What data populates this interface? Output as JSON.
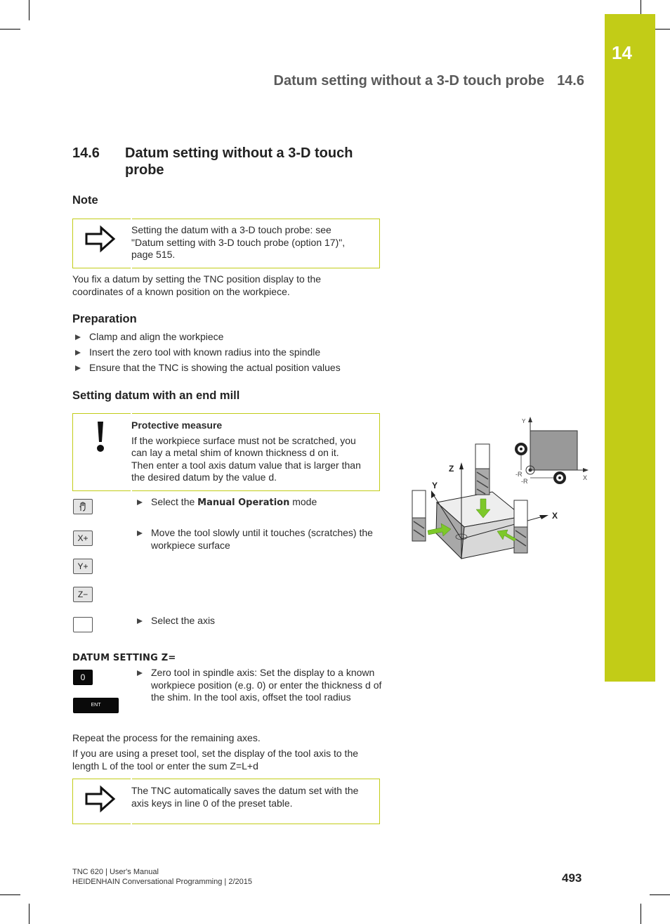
{
  "chapter": {
    "number": "14"
  },
  "running_header": {
    "title": "Datum setting without a 3-D touch probe",
    "section": "14.6"
  },
  "section": {
    "number": "14.6",
    "title": "Datum setting without a 3-D touch probe"
  },
  "note": {
    "heading": "Note",
    "box_text_lines": [
      "Setting the datum with a 3-D touch probe: see",
      "\"Datum setting with 3-D touch probe (option 17)\",",
      "page 515."
    ],
    "box_icon": "arrow-right-icon",
    "paragraph": "You fix a datum by setting the TNC position display to the coordinates of a known position on the workpiece."
  },
  "preparation": {
    "heading": "Preparation",
    "items": [
      "Clamp and align the workpiece",
      "Insert the zero tool with known radius into the spindle",
      "Ensure that the TNC is showing the actual position values"
    ]
  },
  "end_mill": {
    "heading": "Setting datum with an end mill",
    "warning": {
      "icon": "exclamation-icon",
      "title": "Protective measure",
      "lines": [
        "If the workpiece surface must not be scratched, you",
        "can lay a metal shim of known thickness d on it.",
        "Then enter a tool axis datum value that is larger than",
        "the desired datum by the value d."
      ]
    },
    "steps": [
      {
        "key": "hand-icon",
        "pre": "Select the ",
        "bold": "Manual Operation",
        "post": " mode"
      },
      {
        "key": "X+",
        "text": "Move the tool slowly until it touches (scratches) the workpiece surface"
      },
      {
        "key": "Y+"
      },
      {
        "key": "Z−"
      },
      {
        "key": "",
        "text": "Select the axis"
      }
    ],
    "softkey_label": "DATUM SETTING Z=",
    "zero_step": {
      "keys": [
        "0",
        "ENT"
      ],
      "text": "Zero tool in spindle axis: Set the display to a known workpiece position (e.g. 0) or enter the thickness d of the shim. In the tool axis, offset the tool radius"
    },
    "repeat_text": "Repeat the process for the remaining axes.",
    "preset_text": "If you are using a preset tool, set the display of the tool axis to the length L of the tool or enter the sum Z=L+d",
    "final_note": {
      "icon": "arrow-right-icon",
      "lines": [
        "The TNC automatically saves the datum set with the",
        "axis keys in line 0 of the preset table."
      ]
    }
  },
  "figure": {
    "axis_labels": {
      "z": "Z",
      "y": "Y",
      "x": "X"
    },
    "inset_labels": {
      "y": "Y",
      "x": "X",
      "r1": "-R",
      "r2": "-R"
    },
    "arrow_color": "#7dc82a"
  },
  "footer": {
    "line1": "TNC 620 | User's Manual",
    "line2": "HEIDENHAIN Conversational Programming | 2/2015",
    "page": "493"
  },
  "colors": {
    "accent": "#c2cc17"
  }
}
